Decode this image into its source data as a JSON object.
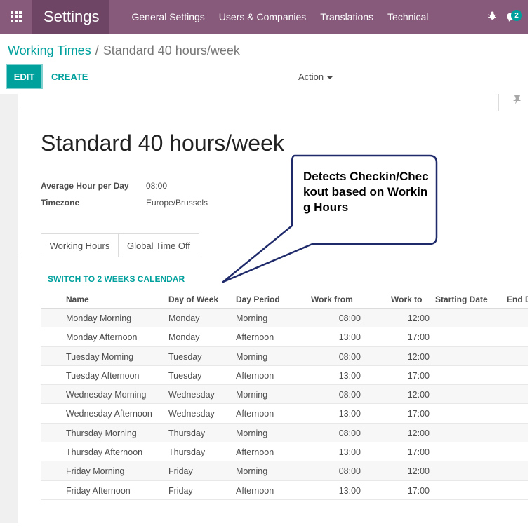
{
  "navbar": {
    "app_title": "Settings",
    "menu": [
      "General Settings",
      "Users & Companies",
      "Translations",
      "Technical"
    ],
    "messages_count": "2"
  },
  "breadcrumb": {
    "parent": "Working Times",
    "separator": "/",
    "current": "Standard 40 hours/week"
  },
  "control": {
    "edit_label": "EDIT",
    "create_label": "CREATE",
    "action_label": "Action"
  },
  "record": {
    "title": "Standard 40 hours/week",
    "fields": [
      {
        "label": "Average Hour per Day",
        "value": "08:00"
      },
      {
        "label": "Timezone",
        "value": "Europe/Brussels"
      }
    ]
  },
  "tabs": [
    {
      "label": "Working Hours",
      "active": true
    },
    {
      "label": "Global Time Off",
      "active": false
    }
  ],
  "switch_link": "SWITCH TO 2 WEEKS CALENDAR",
  "table": {
    "headers": [
      "Name",
      "Day of Week",
      "Day Period",
      "Work from",
      "Work to",
      "Starting Date",
      "End D"
    ],
    "rows": [
      [
        "Monday Morning",
        "Monday",
        "Morning",
        "08:00",
        "12:00"
      ],
      [
        "Monday Afternoon",
        "Monday",
        "Afternoon",
        "13:00",
        "17:00"
      ],
      [
        "Tuesday Morning",
        "Tuesday",
        "Morning",
        "08:00",
        "12:00"
      ],
      [
        "Tuesday Afternoon",
        "Tuesday",
        "Afternoon",
        "13:00",
        "17:00"
      ],
      [
        "Wednesday Morning",
        "Wednesday",
        "Morning",
        "08:00",
        "12:00"
      ],
      [
        "Wednesday Afternoon",
        "Wednesday",
        "Afternoon",
        "13:00",
        "17:00"
      ],
      [
        "Thursday Morning",
        "Thursday",
        "Morning",
        "08:00",
        "12:00"
      ],
      [
        "Thursday Afternoon",
        "Thursday",
        "Afternoon",
        "13:00",
        "17:00"
      ],
      [
        "Friday Morning",
        "Friday",
        "Morning",
        "08:00",
        "12:00"
      ],
      [
        "Friday Afternoon",
        "Friday",
        "Afternoon",
        "13:00",
        "17:00"
      ]
    ]
  },
  "callout": {
    "text": "Detects Checkin/Checkout based on Working Hours"
  },
  "colors": {
    "navbar": "#875a7b",
    "brand": "#6f4566",
    "accent": "#00a09d",
    "callout_border": "#1f2a6b"
  }
}
